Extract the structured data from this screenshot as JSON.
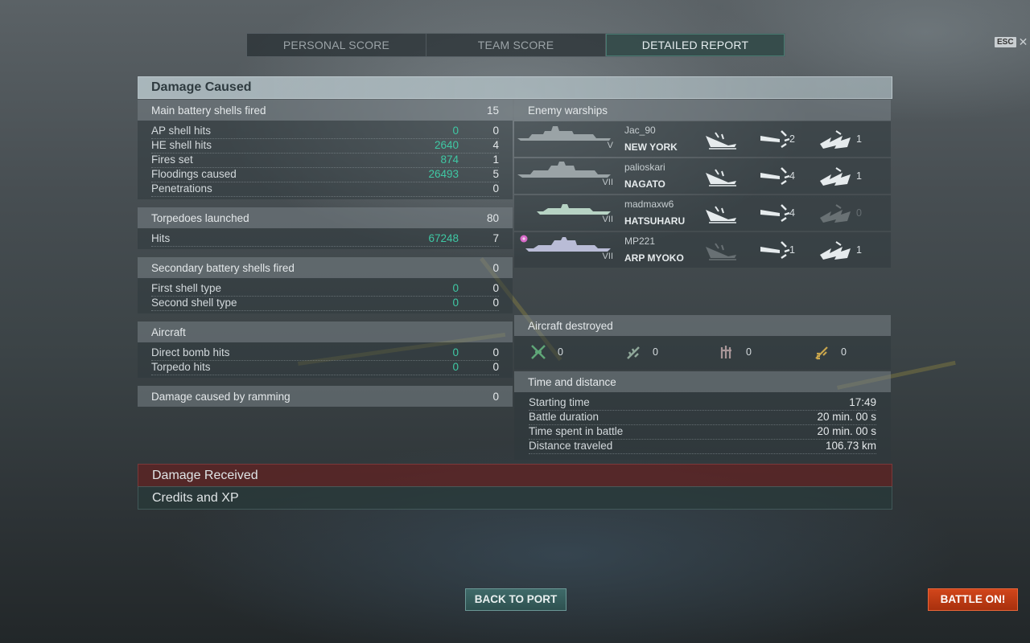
{
  "tabs": [
    {
      "label": "PERSONAL SCORE"
    },
    {
      "label": "TEAM SCORE"
    },
    {
      "label": "DETAILED REPORT"
    }
  ],
  "esc_label": "ESC",
  "close_glyph": "✕",
  "damage_caused": {
    "title": "Damage Caused",
    "main_battery": {
      "label": "Main battery shells fired",
      "value": "15",
      "rows": [
        {
          "label": "AP shell hits",
          "damage": "0",
          "count": "0"
        },
        {
          "label": "HE shell hits",
          "damage": "2640",
          "count": "4"
        },
        {
          "label": "Fires set",
          "damage": "874",
          "count": "1"
        },
        {
          "label": "Floodings caused",
          "damage": "26493",
          "count": "5"
        },
        {
          "label": "Penetrations",
          "damage": "",
          "count": "0"
        }
      ]
    },
    "torpedoes": {
      "label": "Torpedoes launched",
      "value": "80",
      "rows": [
        {
          "label": "Hits",
          "damage": "67248",
          "count": "7"
        }
      ]
    },
    "secondary": {
      "label": "Secondary battery shells fired",
      "value": "0",
      "rows": [
        {
          "label": "First shell type",
          "damage": "0",
          "count": "0"
        },
        {
          "label": "Second shell type",
          "damage": "0",
          "count": "0"
        }
      ]
    },
    "aircraft": {
      "label": "Aircraft",
      "rows": [
        {
          "label": "Direct bomb hits",
          "damage": "0",
          "count": "0"
        },
        {
          "label": "Torpedo hits",
          "damage": "0",
          "count": "0"
        }
      ]
    },
    "ramming": {
      "label": "Damage caused by ramming",
      "value": "0"
    }
  },
  "enemy_warships": {
    "title": "Enemy warships",
    "ships": [
      {
        "player": "Jac_90",
        "name": "NEW YORK",
        "tier": "V",
        "destroyed": true,
        "hits": "2",
        "damage": "1",
        "hits_active": true,
        "damage_active": true,
        "player_icon": "none"
      },
      {
        "player": "palioskari",
        "name": "NAGATO",
        "tier": "VII",
        "destroyed": true,
        "hits": "4",
        "damage": "1",
        "hits_active": true,
        "damage_active": true,
        "player_icon": "none"
      },
      {
        "player": "madmaxw6",
        "name": "HATSUHARU",
        "tier": "VII",
        "destroyed": true,
        "hits": "4",
        "damage": "0",
        "hits_active": true,
        "damage_active": false,
        "player_icon": "none"
      },
      {
        "player": "MP221",
        "name": "ARP MYOKO",
        "tier": "VII",
        "destroyed": false,
        "hits": "1",
        "damage": "1",
        "hits_active": true,
        "damage_active": true,
        "player_icon": "flower-icon"
      }
    ]
  },
  "aircraft_destroyed": {
    "title": "Aircraft destroyed",
    "items": [
      {
        "icon": "fighter-icon",
        "count": "0"
      },
      {
        "icon": "torpedo-bomber-icon",
        "count": "0"
      },
      {
        "icon": "dive-bomber-icon",
        "count": "0"
      },
      {
        "icon": "spotter-plane-icon",
        "count": "0"
      }
    ]
  },
  "time_distance": {
    "title": "Time and distance",
    "rows": [
      {
        "label": "Starting time",
        "value": "17:49"
      },
      {
        "label": "Battle duration",
        "value": "20 min. 00 s"
      },
      {
        "label": "Time spent in battle",
        "value": "20 min. 00 s"
      },
      {
        "label": "Distance traveled",
        "value": "106.73 km"
      }
    ]
  },
  "damage_received_label": "Damage Received",
  "credits_xp_label": "Credits and XP",
  "buttons": {
    "back_to_port": "BACK TO PORT",
    "battle_on": "BATTLE ON!"
  },
  "colors": {
    "damage_value": "#3fc8a4",
    "battle_button": "#c23d14",
    "port_button": "#37605f",
    "received_bar": "#5f2323"
  }
}
